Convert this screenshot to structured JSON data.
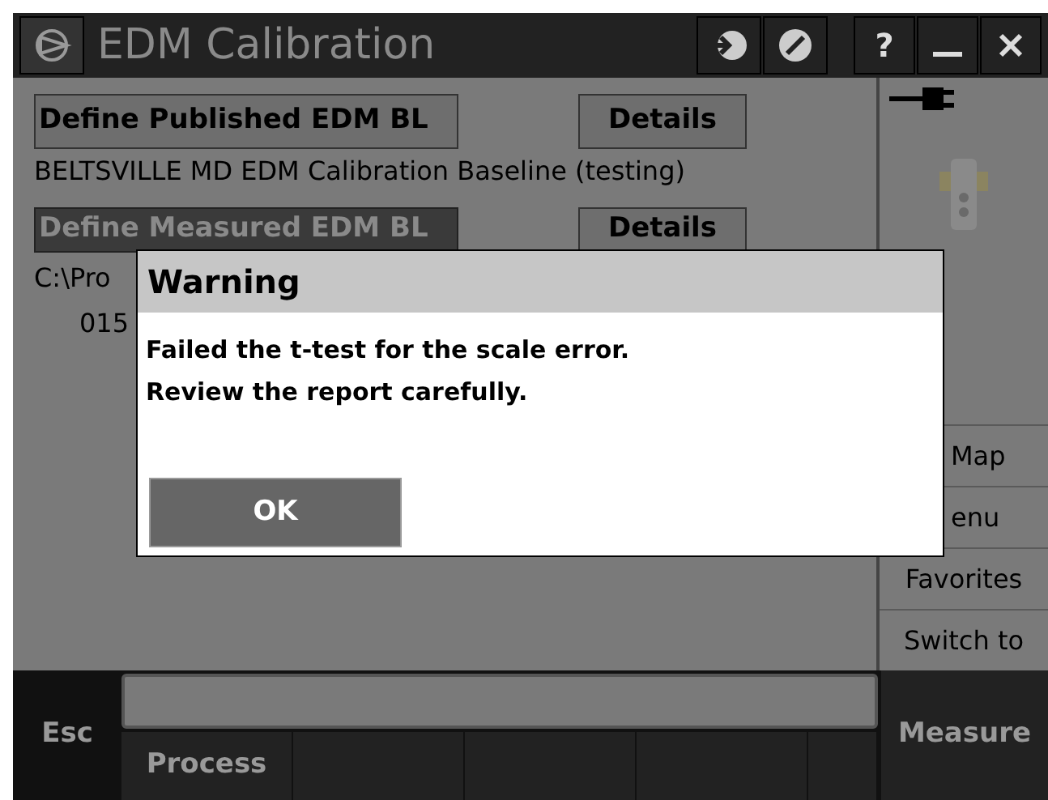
{
  "window": {
    "title": "EDM Calibration"
  },
  "content": {
    "published_button": "Define Published EDM BL",
    "published_details": "Details",
    "published_name": "BELTSVILLE MD EDM Calibration Baseline (testing)",
    "measured_button": "Define Measured EDM BL",
    "measured_details": "Details",
    "path": "C:\\Pro",
    "value": "015"
  },
  "title_buttons": [
    "?"
  ],
  "side_buttons": [
    {
      "label": "Map",
      "covered": true
    },
    {
      "label": "enu",
      "covered": true
    },
    {
      "label": "Favorites",
      "covered": false
    },
    {
      "label": "Switch to",
      "covered": false
    }
  ],
  "softkeys": {
    "esc": "Esc",
    "keys": [
      "Process"
    ],
    "measure": "Measure"
  },
  "dialog": {
    "title": "Warning",
    "lines": [
      "Failed the t-test for the scale error.",
      "Review the report carefully."
    ],
    "button": "OK"
  }
}
